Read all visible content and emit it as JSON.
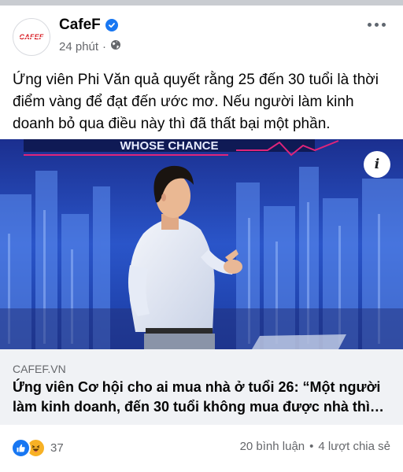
{
  "post": {
    "page_name": "CafeF",
    "logo_text": "CAFEF",
    "time": "24 phút",
    "separator": "·",
    "caption": "Ứng viên Phi Văn quả quyết rằng 25 đến 30 tuổi là thời điểm vàng để đạt đến ước mơ. Nếu người làm kinh doanh bỏ qua điều này thì đã thất bại một phần.",
    "photo_banner_text": "WHOSE CHANCE",
    "info_label": "i"
  },
  "link": {
    "domain": "CAFEF.VN",
    "title": "Ứng viên Cơ hội cho ai mua nhà ở tuổi 26: “Một người làm kinh doanh, đến 30 tuổi không mua được nhà thì…"
  },
  "footer": {
    "reaction_count": "37",
    "comments": "20 bình luận",
    "separator": "•",
    "shares": "4 lượt chia sẻ"
  },
  "icons": [
    "verified-icon",
    "globe-icon",
    "more-icon",
    "info-icon",
    "like-reaction-icon",
    "haha-reaction-icon"
  ],
  "colors": {
    "brand_blue": "#1877f2",
    "logo_red": "#d71920",
    "link_bg": "#f0f2f5",
    "muted_text": "#65676b"
  }
}
